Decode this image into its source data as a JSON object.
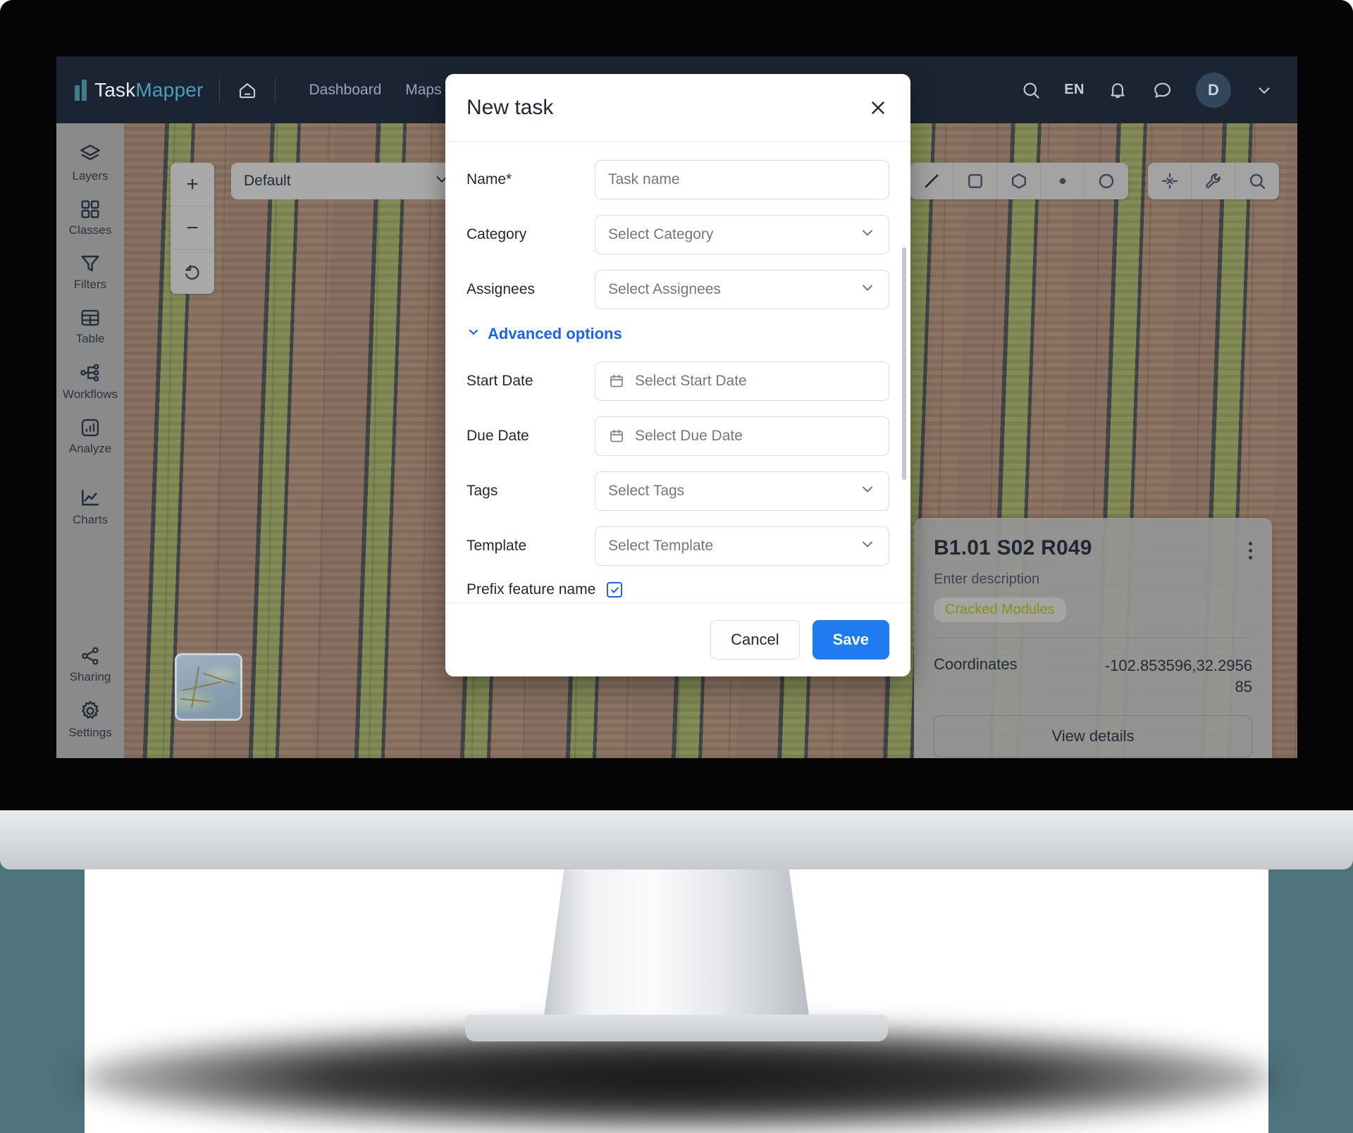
{
  "app": {
    "logo_primary": "Task",
    "logo_secondary": "Mapper"
  },
  "header": {
    "nav": [
      {
        "label": "Dashboard"
      },
      {
        "label": "Maps"
      }
    ],
    "home_icon": "home-icon",
    "search_placeholder": "",
    "search_icon": "search-icon",
    "language": "EN",
    "notifications_icon": "bell-icon",
    "messages_icon": "chat-bubble-icon",
    "avatar_initial": "D",
    "avatar_chevron": "chevron-down-icon"
  },
  "sidebar": {
    "items": [
      {
        "label": "Layers",
        "icon": "layers-icon"
      },
      {
        "label": "Classes",
        "icon": "grid-icon"
      },
      {
        "label": "Filters",
        "icon": "funnel-icon"
      },
      {
        "label": "Table",
        "icon": "table-icon"
      },
      {
        "label": "Workflows",
        "icon": "workflow-icon"
      },
      {
        "label": "Analyze",
        "icon": "analyze-icon"
      },
      {
        "label": "Charts",
        "icon": "chart-line-icon"
      }
    ],
    "bottom_items": [
      {
        "label": "Sharing",
        "icon": "share-icon"
      },
      {
        "label": "Settings",
        "icon": "gear-icon"
      }
    ]
  },
  "map": {
    "zoom_in": "+",
    "zoom_out": "−",
    "reset": "reset-rotation-icon",
    "basemap_value": "Default",
    "basemap_chevron": "chevron-down-icon",
    "draw_tools": [
      {
        "icon": "line-tool-icon"
      },
      {
        "icon": "rectangle-tool-icon"
      },
      {
        "icon": "polygon-tool-icon"
      },
      {
        "icon": "point-tool-icon"
      },
      {
        "icon": "circle-tool-icon"
      }
    ],
    "util_tools": [
      {
        "icon": "snap-tool-icon"
      },
      {
        "icon": "wrench-icon"
      },
      {
        "icon": "search-icon"
      }
    ],
    "minimap": "minimap-thumbnail"
  },
  "feature_card": {
    "title": "B1.01 S02 R049",
    "description": "Enter description",
    "tag": "Cracked Modules",
    "kebab": "more-options-icon",
    "coordinates_label": "Coordinates",
    "coordinates_value": "-102.853596,32.295685",
    "view_details_label": "View details"
  },
  "modal": {
    "title": "New task",
    "close_icon": "close-icon",
    "fields": [
      {
        "label": "Name*",
        "placeholder": "Task name",
        "type": "text"
      },
      {
        "label": "Category",
        "placeholder": "Select Category",
        "type": "select"
      },
      {
        "label": "Assignees",
        "placeholder": "Select Assignees",
        "type": "select"
      }
    ],
    "advanced_label": "Advanced options",
    "advanced_chevron": "chevron-down-icon",
    "advanced_fields": [
      {
        "label": "Start Date",
        "placeholder": "Select Start Date",
        "type": "date"
      },
      {
        "label": "Due Date",
        "placeholder": "Select Due Date",
        "type": "date"
      },
      {
        "label": "Tags",
        "placeholder": "Select Tags",
        "type": "select"
      },
      {
        "label": "Template",
        "placeholder": "Select Template",
        "type": "select"
      }
    ],
    "prefix_label": "Prefix feature name",
    "prefix_checked": true,
    "cancel_label": "Cancel",
    "save_label": "Save"
  },
  "colors": {
    "brand_dark": "#1b2432",
    "brand_accent": "#49a0bd",
    "primary_blue": "#1f7bef",
    "link_blue": "#1565f5",
    "tag_olive": "#8a8f18"
  }
}
